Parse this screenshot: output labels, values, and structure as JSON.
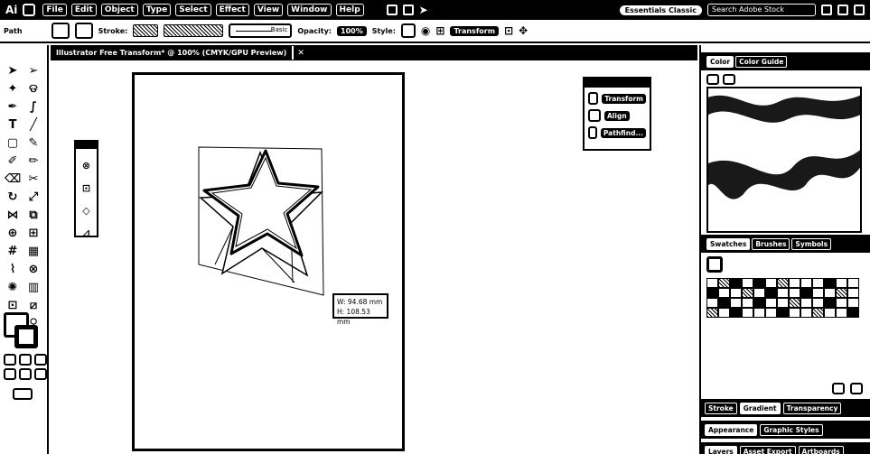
{
  "app": {
    "logo": "Ai"
  },
  "menu": [
    "File",
    "Edit",
    "Object",
    "Type",
    "Select",
    "Effect",
    "View",
    "Window",
    "Help"
  ],
  "workspace": "Essentials Classic",
  "search_placeholder": "Search Adobe Stock",
  "control": {
    "selection_label": "Path",
    "stroke_label": "Stroke:",
    "brush_label": "Basic",
    "opacity_label": "Opacity:",
    "opacity_value": "100%",
    "style_label": "Style:",
    "transform_label": "Transform"
  },
  "document_tab": "Illustrator Free Transform* @ 100% (CMYK/GPU Preview)",
  "tooltip": {
    "width": "W: 94.68 mm",
    "height": "H: 108.53 mm"
  },
  "properties": {
    "items": [
      "Transform",
      "Align",
      "Pathfind..."
    ]
  },
  "panels": {
    "top_tabs": [
      "Color",
      "Color Guide"
    ],
    "mid_tabs": [
      "Swatches",
      "Brushes",
      "Symbols"
    ],
    "row1_tabs": [
      "Stroke",
      "Gradient",
      "Transparency"
    ],
    "row2_tabs": [
      "Appearance",
      "Graphic Styles"
    ],
    "row3_tabs": [
      "Layers",
      "Asset Export",
      "Artboards"
    ]
  }
}
